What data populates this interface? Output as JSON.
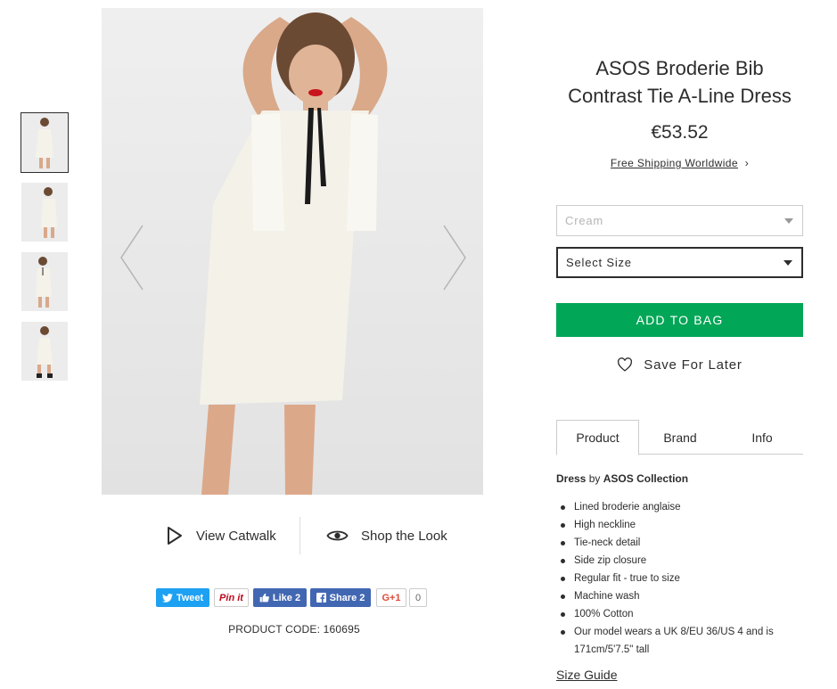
{
  "gallery": {
    "thumbnails": [
      {
        "label": "Image 1",
        "selected": true
      },
      {
        "label": "Image 2",
        "selected": false
      },
      {
        "label": "Image 3",
        "selected": false
      },
      {
        "label": "Image 4",
        "selected": false
      }
    ]
  },
  "media": {
    "view_catwalk": "View Catwalk",
    "shop_the_look": "Shop the Look"
  },
  "share": {
    "tweet": "Tweet",
    "pin": "Pin it",
    "like": "Like 2",
    "fb_share": "Share 2",
    "gplus": "G+1",
    "gplus_count": "0"
  },
  "product_code": "PRODUCT CODE: 160695",
  "product": {
    "title": "ASOS Broderie Bib Contrast Tie A-Line Dress",
    "price": "€53.52",
    "shipping": "Free Shipping Worldwide",
    "shipping_arrow": "›",
    "colour": "Cream",
    "size_placeholder": "Select Size",
    "add_to_bag": "ADD TO BAG",
    "save_for_later": "Save For Later"
  },
  "tabs": [
    "Product",
    "Brand",
    "Info"
  ],
  "description": {
    "type": "Dress",
    "by": "by",
    "brand": "ASOS Collection",
    "details": [
      "Lined broderie anglaise",
      "High neckline",
      "Tie-neck detail",
      "Side zip closure",
      "Regular fit - true to size",
      "Machine wash",
      "100% Cotton",
      "Our model wears a UK 8/EU 36/US 4 and is 171cm/5'7.5\" tall"
    ],
    "size_guide": "Size Guide"
  },
  "colors": {
    "add_to_bag": "#01a657",
    "twitter": "#1da1f2",
    "facebook": "#4267b2",
    "pinterest": "#bd081c",
    "gplus": "#dd4b39",
    "text": "#2d2d2d"
  }
}
